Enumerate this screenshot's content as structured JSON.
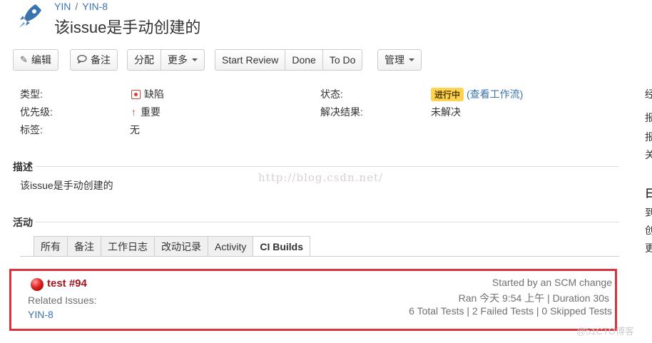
{
  "breadcrumb": {
    "project": "YIN",
    "issue_key": "YIN-8"
  },
  "issue": {
    "title": "该issue是手动创建的"
  },
  "toolbar": {
    "edit": "编辑",
    "comment": "备注",
    "assign": "分配",
    "more": "更多",
    "start_review": "Start Review",
    "done": "Done",
    "todo": "To Do",
    "admin": "管理"
  },
  "details": {
    "type_label": "类型:",
    "type_value": "缺陷",
    "priority_label": "优先级:",
    "priority_value": "重要",
    "labels_label": "标签:",
    "labels_value": "无",
    "status_label": "状态:",
    "status_value": "进行中",
    "workflow_link": "(查看工作流)",
    "resolution_label": "解决结果:",
    "resolution_value": "未解决"
  },
  "description": {
    "heading": "描述",
    "text": "该issue是手动创建的",
    "watermark": "http://blog.csdn.net/"
  },
  "activity": {
    "heading": "活动",
    "tabs": [
      "所有",
      "备注",
      "工作日志",
      "改动记录",
      "Activity",
      "CI Builds"
    ],
    "active_tab": "CI Builds"
  },
  "build": {
    "title": "test #94",
    "related_label": "Related Issues:",
    "related_issue": "YIN-8",
    "started_by": "Started by an SCM change",
    "ran": "Ran 今天 9:54 上午 | Duration 30s",
    "tests": "6 Total Tests | 2 Failed Tests | 0 Skipped Tests",
    "status_color": "#e02424"
  },
  "right_column": [
    "经",
    "报",
    "报",
    "关",
    "日",
    "到",
    "创",
    "更"
  ],
  "corner_watermark": "@51CTO博客",
  "colors": {
    "link": "#3b73af",
    "accent_red": "#d9343e",
    "status_yellow": "#ffd351"
  }
}
